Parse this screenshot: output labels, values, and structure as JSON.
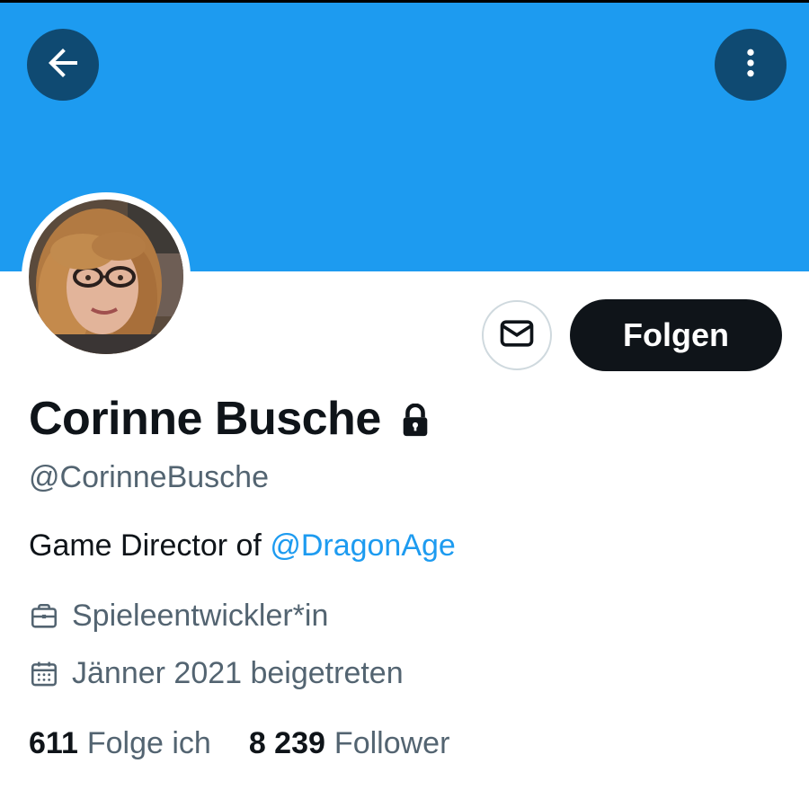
{
  "colors": {
    "banner": "#1d9bf0",
    "overlay_button": "#0f4a72",
    "primary_text": "#0f1419",
    "secondary_text": "#536471",
    "link": "#1d9bf0",
    "follow_button_bg": "#0f1419"
  },
  "header": {
    "back_icon": "arrow-left-icon",
    "more_icon": "more-vertical-icon"
  },
  "profile": {
    "display_name": "Corinne Busche",
    "protected_icon": "lock-icon",
    "handle": "@CorinneBusche",
    "bio": {
      "text": "Game Director of ",
      "mention": "@DragonAge"
    },
    "job": "Spieleentwickler*in",
    "joined": "Jänner 2021 beigetreten",
    "following_count": "611",
    "following_label": "Folge ich",
    "followers_count": "8 239",
    "followers_label": "Follower"
  },
  "actions": {
    "message_icon": "envelope-icon",
    "follow_label": "Folgen"
  }
}
